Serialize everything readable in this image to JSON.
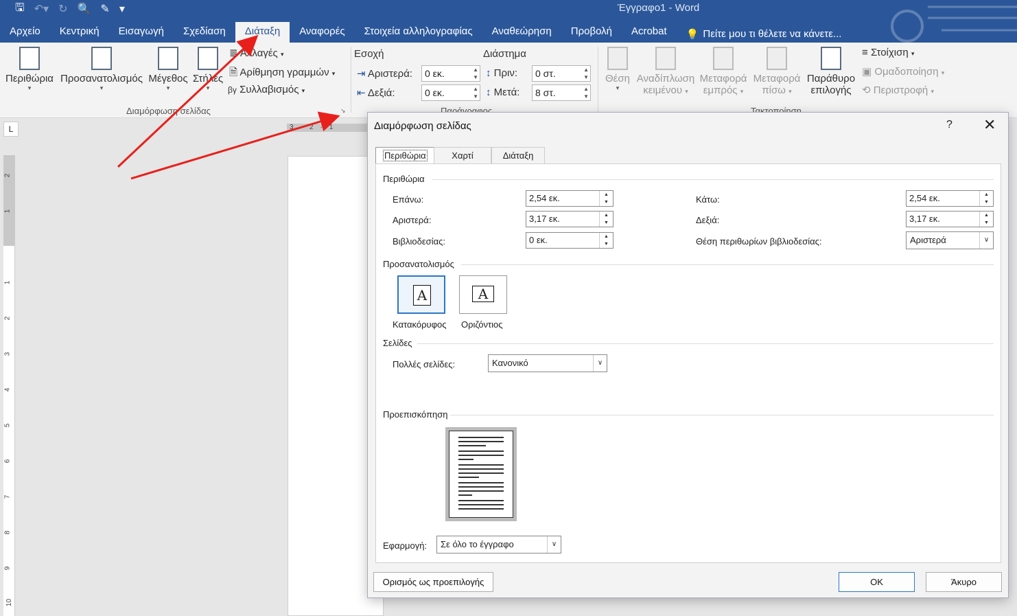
{
  "window": {
    "title": "Έγγραφο1 - Word"
  },
  "qat": {
    "save_icon": "save-icon",
    "undo_icon": "undo-icon",
    "redo_icon": "redo-icon"
  },
  "tabs": [
    {
      "label": "Αρχείο"
    },
    {
      "label": "Κεντρική"
    },
    {
      "label": "Εισαγωγή"
    },
    {
      "label": "Σχεδίαση"
    },
    {
      "label": "Διάταξη"
    },
    {
      "label": "Αναφορές"
    },
    {
      "label": "Στοιχεία αλληλογραφίας"
    },
    {
      "label": "Αναθεώρηση"
    },
    {
      "label": "Προβολή"
    },
    {
      "label": "Acrobat"
    }
  ],
  "tell_me": "Πείτε μου τι θέλετε να κάνετε...",
  "ribbon": {
    "margins": "Περιθώρια",
    "orientation": "Προσανατολισμός",
    "size": "Μέγεθος",
    "columns": "Στήλες",
    "breaks": "Αλλαγές",
    "line_numbers": "Αρίθμηση γραμμών",
    "hyphenation": "Συλλαβισμός",
    "hyphen_glyph": "βγ",
    "page_setup_group": "Διαμόρφωση σελίδας",
    "indent_title": "Εσοχή",
    "indent_left_label": "Αριστερά:",
    "indent_left_value": "0 εκ.",
    "indent_right_label": "Δεξιά:",
    "indent_right_value": "0 εκ.",
    "spacing_title": "Διάστημα",
    "spacing_before_label": "Πριν:",
    "spacing_before_value": "0 στ.",
    "spacing_after_label": "Μετά:",
    "spacing_after_value": "8 στ.",
    "paragraph_group": "Παράγραφος",
    "position_line1": "Θέση",
    "wrap_line1": "Αναδίπλωση",
    "wrap_line2": "κειμένου",
    "forward_line1": "Μεταφορά",
    "forward_line2": "εμπρός",
    "backward_line1": "Μεταφορά",
    "backward_line2": "πίσω",
    "selection_line1": "Παράθυρο",
    "selection_line2": "επιλογής",
    "align": "Στοίχιση",
    "group": "Ομαδοποίηση",
    "rotate": "Περιστροφή",
    "arrange_group": "Τακτοποίηση"
  },
  "dialog": {
    "title": "Διαμόρφωση σελίδας",
    "help": "?",
    "tabs": [
      "Περιθώρια",
      "Χαρτί",
      "Διάταξη"
    ],
    "margins_section": "Περιθώρια",
    "top_label": "Επάνω:",
    "top_value": "2,54 εκ.",
    "bottom_label": "Κάτω:",
    "bottom_value": "2,54 εκ.",
    "left_label": "Αριστερά:",
    "left_value": "3,17 εκ.",
    "right_label": "Δεξιά:",
    "right_value": "3,17 εκ.",
    "gutter_label": "Βιβλιοδεσίας:",
    "gutter_value": "0 εκ.",
    "gutter_pos_label": "Θέση περιθωρίων βιβλιοδεσίας:",
    "gutter_pos_value": "Αριστερά",
    "orientation_section": "Προσανατολισμός",
    "portrait": "Κατακόρυφος",
    "landscape": "Οριζόντιος",
    "orient_glyph": "A",
    "pages_section": "Σελίδες",
    "multiple_pages_label": "Πολλές σελίδες:",
    "multiple_pages_value": "Κανονικό",
    "preview_section": "Προεπισκόπηση",
    "apply_label": "Εφαρμογή:",
    "apply_value": "Σε όλο το έγγραφο",
    "set_default": "Ορισμός ως προεπιλογής",
    "ok": "ΟΚ",
    "cancel": "Άκυρο"
  },
  "ruler": {
    "corner": "L",
    "top_marks": "3·2·1",
    "left_numbers": [
      "2",
      "1",
      "1",
      "2",
      "3",
      "4",
      "5",
      "6",
      "7",
      "8",
      "9",
      "10"
    ]
  },
  "colors": {
    "accent": "#2b579a",
    "annotation_arrow": "#e8201c"
  }
}
